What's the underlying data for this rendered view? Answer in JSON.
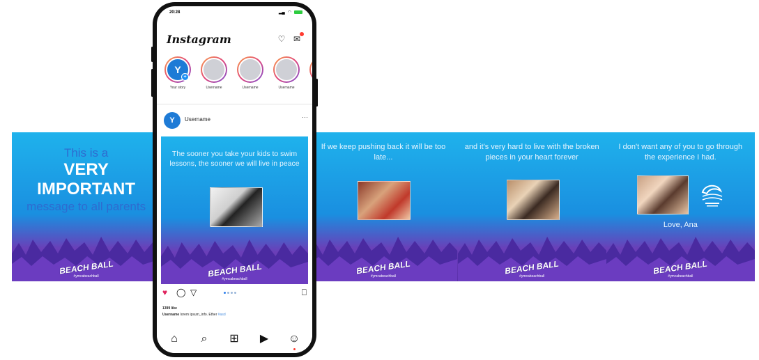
{
  "phone": {
    "status_time": "20:28",
    "app_name": "Instagram",
    "stories": [
      {
        "label": "Your story",
        "own": true,
        "glyph": "Y"
      },
      {
        "label": "Username"
      },
      {
        "label": "Username"
      },
      {
        "label": "Username"
      },
      {
        "label": "Us"
      }
    ],
    "post": {
      "username": "Username",
      "more": "···",
      "text": "The sooner you take your kids to swim lessons, the sooner we will live in peace",
      "hashtag": "#ymcabeachball",
      "logo_text": "BEACH BALL",
      "likes": "1399 like",
      "caption_user": "Username",
      "caption_text": "lorem ipsum_info. Ether",
      "caption_tag": "#asd"
    },
    "carousel_dots": 4,
    "carousel_active": 0
  },
  "panels": [
    {
      "id": "intro",
      "line1": "This is a",
      "line2": "VERY",
      "line3": "IMPORTANT",
      "line4": "message to all parents",
      "hashtag": "#ymcabeachball",
      "logo_text": "BEACH BALL"
    },
    {
      "id": "p2",
      "text": "If we keep pushing back it will be too late...",
      "hashtag": "#ymcabeachball",
      "logo_text": "BEACH BALL"
    },
    {
      "id": "p3",
      "text": "and it's very hard to live with the broken pieces in your heart forever",
      "hashtag": "#ymcabeachball",
      "logo_text": "BEACH BALL"
    },
    {
      "id": "p4",
      "text": "I don't want any of you to go through the experience I had.",
      "signoff": "Love, Ana",
      "hashtag": "#ymcabeachball",
      "logo_text": "BEACH BALL"
    }
  ],
  "colors": {
    "heart": "#e0245e",
    "accent_blue": "#1fb2ec",
    "purple": "#5b2ea6"
  }
}
